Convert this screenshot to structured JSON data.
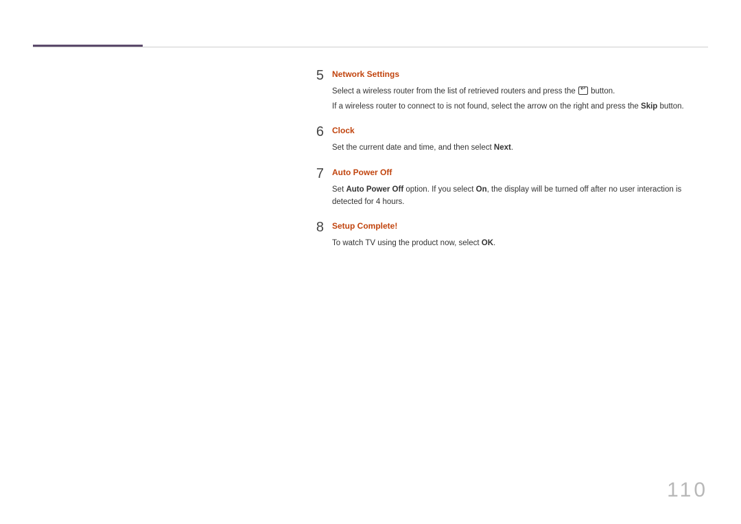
{
  "page_number": "110",
  "steps": [
    {
      "num": "5",
      "title": "Network Settings",
      "paragraphs": [
        {
          "segments": [
            {
              "t": "Select a wireless router from the list of retrieved routers and press the "
            },
            {
              "icon": "enter"
            },
            {
              "t": " button."
            }
          ]
        },
        {
          "segments": [
            {
              "t": "If a wireless router to connect to is not found, select the arrow on the right and press the "
            },
            {
              "t": "Skip",
              "bold": true
            },
            {
              "t": " button."
            }
          ]
        }
      ]
    },
    {
      "num": "6",
      "title": "Clock",
      "paragraphs": [
        {
          "segments": [
            {
              "t": "Set the current date and time, and then select "
            },
            {
              "t": "Next",
              "bold": true
            },
            {
              "t": "."
            }
          ]
        }
      ]
    },
    {
      "num": "7",
      "title": "Auto Power Off",
      "paragraphs": [
        {
          "segments": [
            {
              "t": "Set "
            },
            {
              "t": "Auto Power Off",
              "bold": true
            },
            {
              "t": " option. If you select "
            },
            {
              "t": "On",
              "bold": true
            },
            {
              "t": ", the display will be turned off after no user interaction is detected for 4 hours."
            }
          ]
        }
      ]
    },
    {
      "num": "8",
      "title": "Setup Complete!",
      "paragraphs": [
        {
          "segments": [
            {
              "t": "To watch TV using the product now, select "
            },
            {
              "t": "OK",
              "bold": true
            },
            {
              "t": "."
            }
          ]
        }
      ]
    }
  ]
}
